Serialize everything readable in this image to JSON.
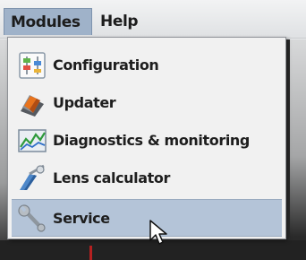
{
  "menubar": {
    "modules_label": "Modules",
    "help_label": "Help"
  },
  "modules_menu": {
    "items": [
      {
        "label": "Configuration",
        "icon": "configuration-sliders-icon"
      },
      {
        "label": "Updater",
        "icon": "updater-icon"
      },
      {
        "label": "Diagnostics & monitoring",
        "icon": "diagnostics-chart-icon"
      },
      {
        "label": "Lens calculator",
        "icon": "lens-calculator-icon"
      },
      {
        "label": "Service",
        "icon": "service-wrench-icon",
        "highlighted": true
      }
    ]
  },
  "colors": {
    "menubar_active": "#9fb2c9",
    "menu_background": "#f1f1f1",
    "menu_highlight": "#b4c4d8"
  }
}
